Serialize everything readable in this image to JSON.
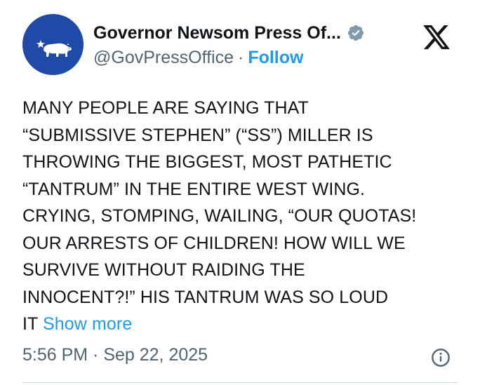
{
  "account": {
    "display_name": "Governor Newsom Press Of...",
    "handle": "@GovPressOffice",
    "separator": "·",
    "follow_label": "Follow"
  },
  "tweet": {
    "lines": [
      "MANY PEOPLE ARE SAYING THAT",
      "“SUBMISSIVE STEPHEN” (“SS”) MILLER IS",
      "THROWING THE BIGGEST, MOST PATHETIC",
      "“TANTRUM” IN THE ENTIRE WEST WING.",
      "CRYING, STOMPING, WAILING, “OUR QUOTAS!",
      "OUR ARRESTS OF CHILDREN! HOW WILL WE",
      "SURVIVE WITHOUT RAIDING THE",
      "INNOCENT?!” HIS TANTRUM WAS SO LOUD",
      "IT"
    ],
    "show_more_label": "Show more",
    "timestamp": "5:56 PM · Sep 22, 2025"
  },
  "icons": {
    "avatar": "california-bear-flag-icon",
    "verified": "verified-badge-icon",
    "platform": "x-logo-icon",
    "info": "info-icon"
  },
  "colors": {
    "avatar_bg": "#1f4aa8",
    "link": "#1d9bf0",
    "secondary_text": "#536471",
    "badge": "#829aab"
  }
}
